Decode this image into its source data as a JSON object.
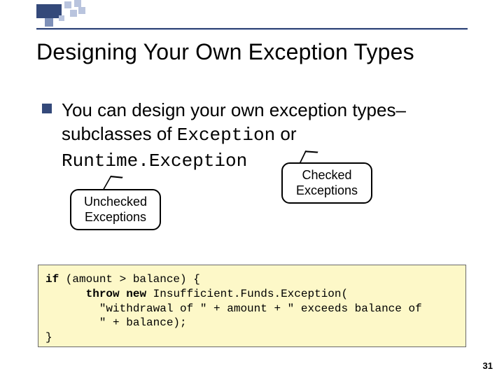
{
  "title": "Designing Your Own Exception Types",
  "bullet": {
    "line1_a": "You can design your own exception types–",
    "line1_b": "subclasses of ",
    "code1": "Exception",
    "line1_c": " or",
    "code2": "Runtime.Exception"
  },
  "callouts": {
    "unchecked_l1": "Unchecked",
    "unchecked_l2": "Exceptions",
    "checked_l1": "Checked",
    "checked_l2": "Exceptions"
  },
  "code": {
    "kw_if": "if",
    "l1_rest": " (amount > balance) {",
    "l2_indent": "      ",
    "kw_throw": "throw",
    "sp": " ",
    "kw_new": "new",
    "l2_rest": " Insufficient.Funds.Exception(",
    "l3": "        \"withdrawal of \" + amount + \" exceeds balance of",
    "l4": "        \" + balance);",
    "l5": "}"
  },
  "page_number": "31"
}
